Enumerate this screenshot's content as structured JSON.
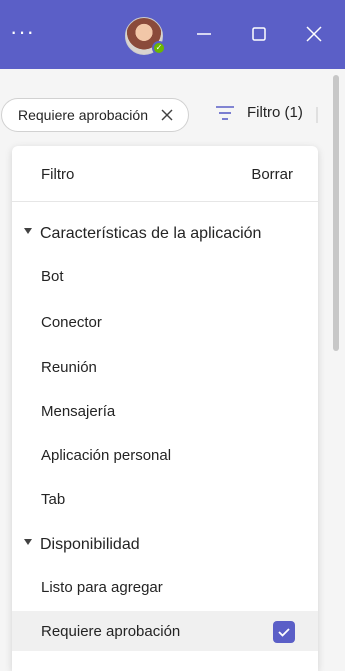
{
  "titlebar": {
    "more_icon": "more-horizontal-icon",
    "avatar_alt": "",
    "presence_status_color": "#6bb700",
    "accent_color": "#5b5fc7"
  },
  "active_filter_chip": {
    "label": "Requiere aprobación",
    "remove_icon": "close-icon"
  },
  "filter_button": {
    "label": "Filtro (1)",
    "icon": "filter-icon"
  },
  "panel": {
    "title": "Filtro",
    "clear_label": "Borrar",
    "sections": [
      {
        "label": "Características de la aplicación",
        "items": [
          {
            "label": "Bot"
          },
          {
            "label": "Conector"
          },
          {
            "label": "Reunión"
          },
          {
            "label": "Mensajería"
          },
          {
            "label": "Aplicación personal"
          },
          {
            "label": "Tab"
          }
        ]
      },
      {
        "label": "Disponibilidad",
        "items": [
          {
            "label": "Listo para agregar"
          },
          {
            "label": "Requiere aprobación",
            "checked": true
          }
        ]
      }
    ]
  }
}
